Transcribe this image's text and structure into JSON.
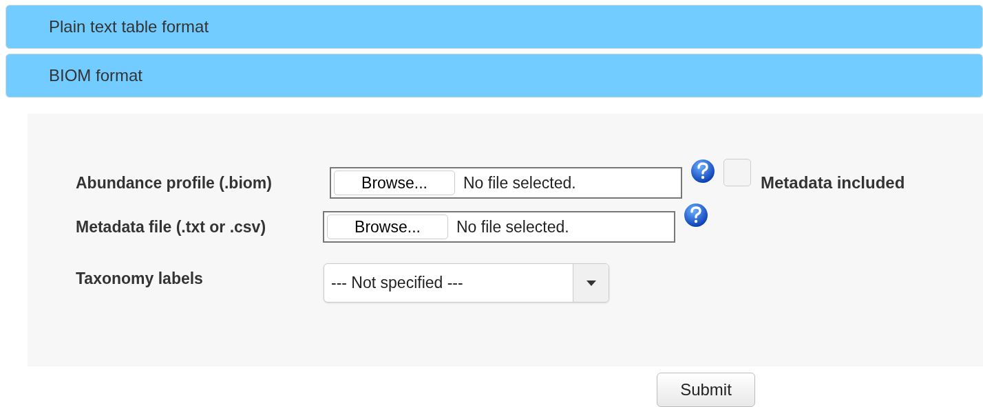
{
  "sections": [
    {
      "title": "Plain text table format"
    },
    {
      "title": "BIOM format"
    }
  ],
  "form": {
    "rows": [
      {
        "kind": "file",
        "label": "Abundance profile (.biom)",
        "button": "Browse...",
        "value": "No file selected.",
        "help": true,
        "checkbox": {
          "label": "Metadata included",
          "checked": false
        }
      },
      {
        "kind": "file",
        "label": "Metadata file (.txt or .csv)",
        "button": "Browse...",
        "value": "No file selected.",
        "help": true
      },
      {
        "kind": "select",
        "label": "Taxonomy labels",
        "value": "--- Not specified ---"
      }
    ]
  },
  "submit": "Submit"
}
